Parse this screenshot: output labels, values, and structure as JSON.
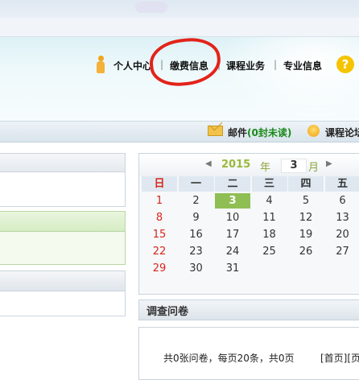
{
  "nav": {
    "items": [
      "个人中心",
      "缴费信息",
      "课程业务",
      "专业信息"
    ],
    "separator": "|"
  },
  "help_icon": "?",
  "toolbar": {
    "mail_label": "邮件",
    "mail_unread": "(0封未读)",
    "forum_label": "课程论坛"
  },
  "calendar": {
    "prev": "◀",
    "next": "▶",
    "year": "2015",
    "year_label": "年",
    "month": "3",
    "month_label": "月",
    "weekdays": [
      "日",
      "一",
      "二",
      "三",
      "四",
      "五"
    ],
    "weeks": [
      [
        "1",
        "2",
        "3",
        "4",
        "5",
        "6"
      ],
      [
        "8",
        "9",
        "10",
        "11",
        "12",
        "13"
      ],
      [
        "15",
        "16",
        "17",
        "18",
        "19",
        "20"
      ],
      [
        "22",
        "23",
        "24",
        "25",
        "26",
        "27"
      ],
      [
        "29",
        "30",
        "31",
        "",
        "",
        ""
      ]
    ],
    "today": "3"
  },
  "survey": {
    "title": "调查问卷",
    "pager_text": "共0张问卷，每页20条，共0页",
    "pager_buttons": "[首页][页"
  },
  "colors": {
    "annotation": "#e2231a",
    "today": "#8fbf54",
    "sunday": "#d7261b",
    "unread": "#1a8a1a"
  }
}
